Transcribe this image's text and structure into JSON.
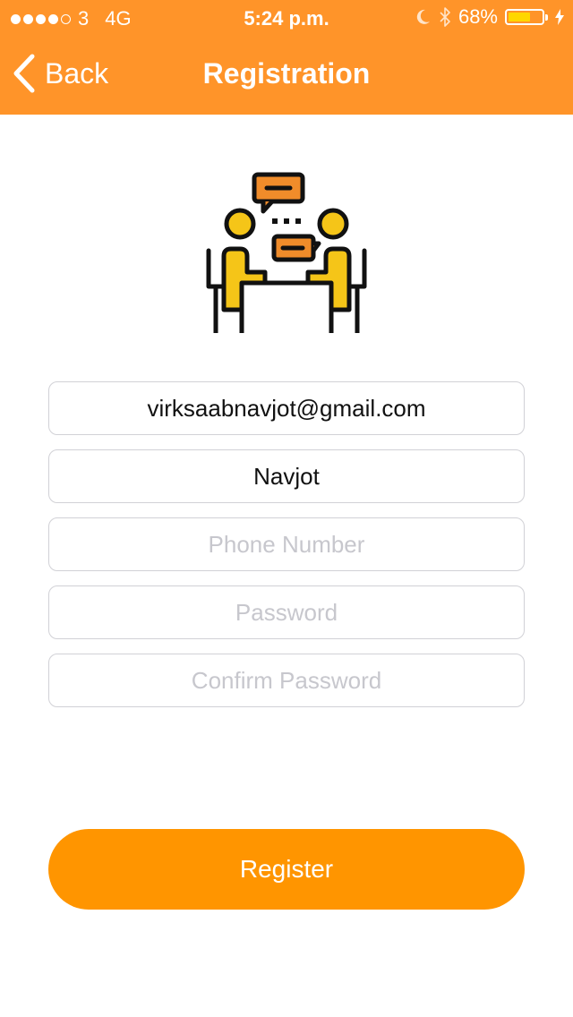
{
  "status_bar": {
    "carrier": "3",
    "network": "4G",
    "time": "5:24 p.m.",
    "battery_percent": "68%",
    "battery_level": 0.68,
    "signal_bars_filled": 4,
    "signal_bars_total": 5,
    "icons": [
      "moon-icon",
      "bluetooth-icon",
      "battery-icon",
      "charging-bolt-icon"
    ]
  },
  "nav": {
    "back_label": "Back",
    "title": "Registration"
  },
  "illustration": {
    "icon": "meeting-conversation-icon",
    "colors": {
      "person": "#F5C518",
      "bubble": "#F08C2A",
      "outline": "#111111"
    }
  },
  "form": {
    "email": {
      "value": "virksaabnavjot@gmail.com",
      "placeholder": ""
    },
    "name": {
      "value": "Navjot",
      "placeholder": ""
    },
    "phone": {
      "value": "",
      "placeholder": "Phone Number"
    },
    "password": {
      "value": "",
      "placeholder": "Password"
    },
    "confirm_password": {
      "value": "",
      "placeholder": "Confirm Password"
    }
  },
  "register_button": {
    "label": "Register"
  },
  "colors": {
    "header_bg": "#FF9429",
    "button_bg": "#FF9500",
    "field_border": "#D1D1D6",
    "placeholder": "#C7C7CD"
  }
}
